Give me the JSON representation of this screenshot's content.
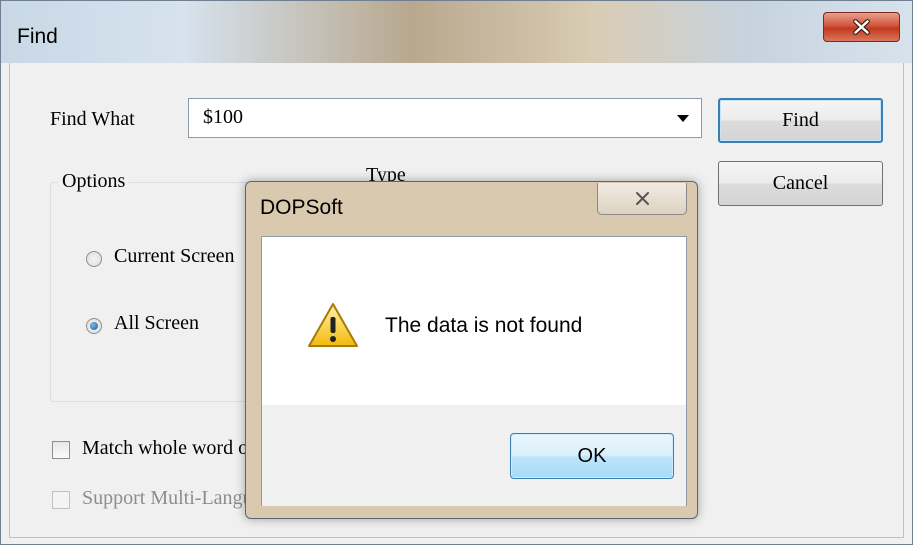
{
  "find_dialog": {
    "title": "Find",
    "find_what_label": "Find What",
    "find_what_value": "$100",
    "find_button": "Find",
    "cancel_button": "Cancel",
    "options_group_label": "Options",
    "type_group_label": "Type",
    "options": [
      {
        "label": "Current Screen",
        "selected": false
      },
      {
        "label": "All Screen",
        "selected": true
      }
    ],
    "match_whole_word_label": "Match whole word only",
    "support_multi_language_label": "Support Multi-Language"
  },
  "message_box": {
    "title": "DOPSoft",
    "message": "The data is not found",
    "ok_button": "OK",
    "icon": "warning-icon"
  },
  "colors": {
    "close_button_red": "#c0381e",
    "default_button_border": "#3c7fb1",
    "warning_yellow": "#f5c518"
  }
}
